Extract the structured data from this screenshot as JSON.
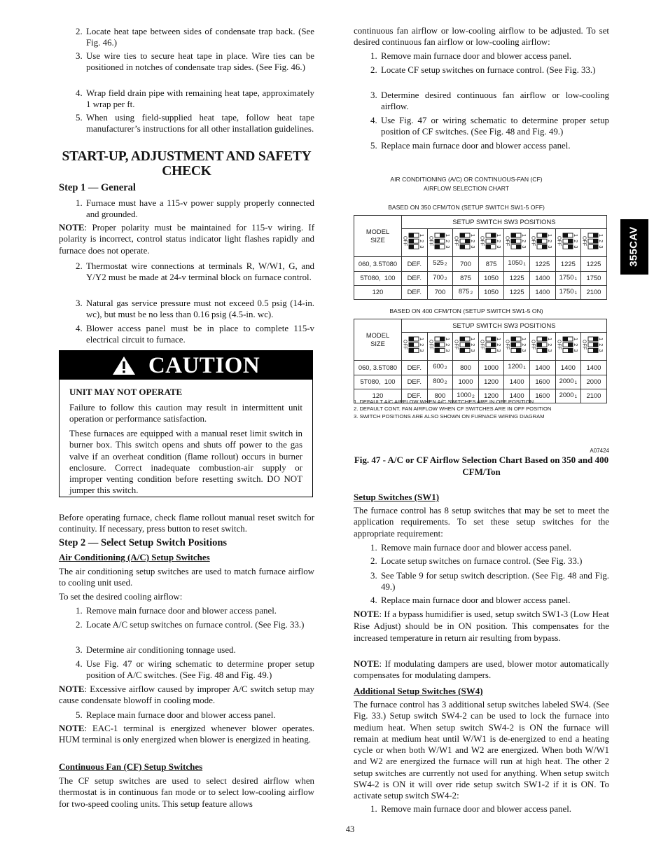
{
  "left": {
    "heat_tape_items": [
      {
        "n": "2.",
        "t": "Locate heat tape between sides of condensate trap back. (See Fig. 46.)"
      },
      {
        "n": "3.",
        "t": "Use wire ties to secure heat tape in place. Wire ties can be positioned in notches of condensate trap sides. (See Fig. 46.)"
      },
      {
        "n": "4.",
        "t": "Wrap field drain pipe with remaining heat tape, approximately 1 wrap per ft."
      },
      {
        "n": "5.",
        "t": "When using field-supplied heat tape, follow heat tape manufacturer’s instructions for all other installation guidelines."
      }
    ],
    "section_heading": "START-UP, ADJUSTMENT AND SAFETY CHECK",
    "step1": {
      "heading": "Step 1 — General",
      "item1": {
        "n": "1.",
        "t": "Furnace must have a 115-v power supply properly connected and grounded."
      },
      "note": {
        "label": "NOTE",
        "text": ":  Proper polarity must be maintained for 115-v wiring. If polarity is incorrect, control status indicator light flashes rapidly and furnace does not operate."
      },
      "items": [
        {
          "n": "2.",
          "t": "Thermostat wire connections at terminals R, W/W1, G, and Y/Y2 must be made at 24-v terminal block on furnace control."
        },
        {
          "n": "3.",
          "t": "Natural gas service pressure must not exceed 0.5 psig (14-in. wc), but must be no less than 0.16 psig (4.5-in. wc)."
        },
        {
          "n": "4.",
          "t": "Blower access panel must be in place to complete 115-v electrical circuit to furnace."
        }
      ]
    },
    "caution": {
      "title": "CAUTION",
      "heading": "UNIT MAY NOT OPERATE",
      "p1": "Failure to follow this caution may result in intermittent unit operation or performance satisfaction.",
      "p2": "These furnaces are equipped with a manual reset limit switch in burner box. This switch opens and shuts off power to the gas valve if an overheat condition (flame rollout) occurs in burner enclosure. Correct inadequate combustion-air supply or improper venting condition before resetting switch. DO NOT jumper this switch."
    },
    "rollout_para": "Before operating furnace, check flame rollout manual reset switch for continuity. If necessary, press button to reset switch.",
    "step2": {
      "heading": "Step 2 — Select Setup Switch Positions",
      "ac_heading": "Air Conditioning (A/C) Setup Switches",
      "ac_p1": "The air conditioning setup switches are used to match furnace airflow to cooling unit used.",
      "ac_p2": "To set the desired cooling airflow:",
      "ac_items": [
        {
          "n": "1.",
          "t": "Remove main furnace door and blower access panel."
        },
        {
          "n": "2.",
          "t": "Locate A/C setup switches on furnace control. (See Fig. 33.)"
        },
        {
          "n": "3.",
          "t": "Determine air conditioning tonnage used."
        },
        {
          "n": "4.",
          "t": "Use Fig. 47 or wiring schematic to determine proper setup position of A/C switches. (See Fig. 48 and Fig. 49.)"
        }
      ],
      "ac_note1": {
        "label": "NOTE",
        "text": ":  Excessive airflow caused by improper A/C switch setup may cause condensate blowoff in cooling mode."
      },
      "ac_item5": {
        "n": "5.",
        "t": "Replace main furnace door and blower access panel."
      },
      "ac_note2": {
        "label": "NOTE",
        "text": ":  EAC-1 terminal is energized whenever blower operates. HUM terminal is only energized when blower is energized in heating."
      },
      "cf_heading": "Continuous Fan (CF) Setup Switches",
      "cf_p1": "The CF setup switches are used to select desired airflow when thermostat is in continuous fan mode or to select low-cooling airflow for two-speed cooling units. This setup feature allows"
    }
  },
  "right": {
    "cf_p2": "continuous fan airflow or low-cooling airflow to be adjusted. To set desired continuous fan airflow or low-cooling airflow:",
    "cf_items": [
      {
        "n": "1.",
        "t": "Remove main furnace door and blower access panel."
      },
      {
        "n": "2.",
        "t": "Locate CF setup switches on furnace control. (See Fig. 33.)"
      },
      {
        "n": "3.",
        "t": "Determine desired continuous fan airflow or low-cooling airflow."
      },
      {
        "n": "4.",
        "t": "Use Fig. 47 or wiring schematic to determine proper setup position of CF switches. (See Fig. 48 and Fig. 49.)"
      },
      {
        "n": "5.",
        "t": "Replace main furnace door and blower access panel."
      }
    ],
    "chart": {
      "title_line1": "AIR CONDITIONING (A/C) OR CONTINUOUS-FAN (CF)",
      "title_line2": "AIRFLOW SELECTION CHART",
      "switch_off_label": "OFF",
      "switch_numbers": [
        "1",
        "2",
        "3"
      ],
      "tables": [
        {
          "subtitle": "BASED ON 350 CFM/TON (SETUP SWITCH SW1-5 OFF)",
          "model_header": [
            "MODEL",
            "SIZE"
          ],
          "group_header": "SETUP SWITCH SW3 POSITIONS",
          "switch_positions_on": [
            [
              0,
              0,
              0
            ],
            [
              1,
              0,
              0
            ],
            [
              0,
              1,
              0
            ],
            [
              1,
              1,
              0
            ],
            [
              0,
              0,
              1
            ],
            [
              1,
              0,
              1
            ],
            [
              0,
              1,
              1
            ],
            [
              1,
              1,
              1
            ]
          ],
          "rows": [
            {
              "model": "060, 3.5T080",
              "values": [
                "DEF.",
                {
                  "v": "525",
                  "fn": "2"
                },
                "700",
                "875",
                {
                  "v": "1050",
                  "fn": "1"
                },
                "1225",
                "1225",
                "1225"
              ]
            },
            {
              "model": "5T080,  100",
              "values": [
                "DEF.",
                {
                  "v": "700",
                  "fn": "2"
                },
                "875",
                "1050",
                "1225",
                "1400",
                {
                  "v": "1750",
                  "fn": "1"
                },
                "1750"
              ]
            },
            {
              "model": "120",
              "values": [
                "DEF.",
                "700",
                {
                  "v": "875",
                  "fn": "2"
                },
                "1050",
                "1225",
                "1400",
                {
                  "v": "1750",
                  "fn": "1"
                },
                "2100"
              ]
            }
          ]
        },
        {
          "subtitle": "BASED ON 400 CFM/TON (SETUP SWITCH SW1-5 ON)",
          "model_header": [
            "MODEL",
            "SIZE"
          ],
          "group_header": "SETUP SWITCH SW3 POSITIONS",
          "switch_positions_on": [
            [
              0,
              0,
              0
            ],
            [
              1,
              0,
              0
            ],
            [
              0,
              1,
              0
            ],
            [
              1,
              1,
              0
            ],
            [
              0,
              0,
              1
            ],
            [
              1,
              0,
              1
            ],
            [
              0,
              1,
              1
            ],
            [
              1,
              1,
              1
            ]
          ],
          "rows": [
            {
              "model": "060, 3.5T080",
              "values": [
                "DEF.",
                {
                  "v": "600",
                  "fn": "2"
                },
                "800",
                "1000",
                {
                  "v": "1200",
                  "fn": "1"
                },
                "1400",
                "1400",
                "1400"
              ]
            },
            {
              "model": "5T080,  100",
              "values": [
                "DEF.",
                {
                  "v": "800",
                  "fn": "2"
                },
                "1000",
                "1200",
                "1400",
                "1600",
                {
                  "v": "2000",
                  "fn": "1"
                },
                "2000"
              ]
            },
            {
              "model": "120",
              "values": [
                "DEF.",
                "800",
                {
                  "v": "1000",
                  "fn": "2"
                },
                "1200",
                "1400",
                "1600",
                {
                  "v": "2000",
                  "fn": "1"
                },
                "2100"
              ]
            }
          ]
        }
      ],
      "footnotes": [
        "1. DEFAULT A/C AIRFLOW WHEN A/C SWITCHES ARE IN OFF POSITION",
        "2. DEFAULT CONT. FAN AIRFLOW WHEN CF SWITCHES ARE IN OFF POSITION",
        "3. SWITCH POSITIONS ARE ALSO SHOWN ON FURNACE WIRING DIAGRAM"
      ],
      "figure_code": "A07424",
      "caption": "Fig. 47 - A/C or CF Airflow Selection Chart Based on 350 and 400 CFM/Ton"
    },
    "sw1": {
      "heading": "Setup Switches (SW1)",
      "p1": "The furnace control has 8 setup switches that may be set to meet the application requirements. To set these setup switches for the appropriate requirement:",
      "items": [
        {
          "n": "1.",
          "t": "Remove main furnace door and blower access panel."
        },
        {
          "n": "2.",
          "t": "Locate setup switches on furnace control. (See Fig. 33.)"
        },
        {
          "n": "3.",
          "t": "See Table 9 for setup switch description. (See Fig. 48 and Fig. 49.)"
        },
        {
          "n": "4.",
          "t": "Replace main furnace door and blower access panel."
        }
      ],
      "note1": {
        "label": "NOTE",
        "text": ":  If a bypass humidifier is used, setup switch SW1-3 (Low Heat Rise Adjust) should be in ON position. This compensates for the increased temperature in return air resulting from bypass."
      },
      "note2": {
        "label": "NOTE",
        "text": ":   If modulating dampers are used, blower motor automatically compensates for modulating dampers."
      }
    },
    "sw4": {
      "heading": "Additional Setup Switches (SW4)",
      "p1": "The furnace control has 3 additional setup switches labeled SW4. (See Fig. 33.) Setup switch SW4-2 can be used to lock the furnace into medium heat. When setup switch SW4-2 is ON the furnace will remain at medium heat until W/W1 is de-energized to end a heating cycle or when both W/W1 and W2 are energized. When both W/W1 and W2 are energized the furnace will run at high heat. The other 2 setup switches are currently not used for anything. When setup switch SW4-2 is ON it will over ride setup switch SW1-2 if it is ON. To activate setup switch SW4-2:",
      "item1": {
        "n": "1.",
        "t": "Remove main furnace door and blower access panel."
      }
    }
  },
  "side_tab": "355CAV",
  "page_number": "43"
}
